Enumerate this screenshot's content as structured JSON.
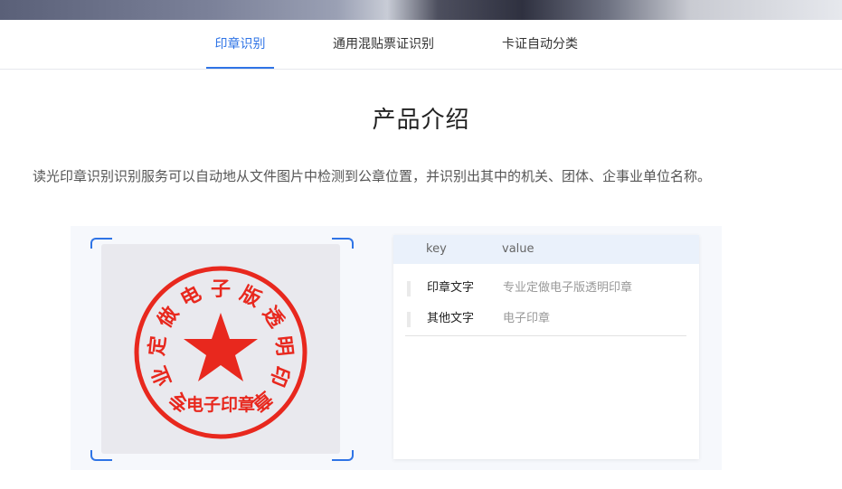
{
  "tabs": [
    {
      "label": "印章识别",
      "active": true
    },
    {
      "label": "通用混贴票证识别",
      "active": false
    },
    {
      "label": "卡证自动分类",
      "active": false
    }
  ],
  "section": {
    "title": "产品介绍",
    "description": "读光印章识别识别服务可以自动地从文件图片中检测到公章位置，并识别出其中的机关、团体、企事业单位名称。"
  },
  "demo": {
    "stamp": {
      "ring_text": "专业定做电子版透明印章",
      "center_text": "电子印章",
      "color": "#e8281e"
    },
    "table": {
      "headers": {
        "key": "key",
        "value": "value"
      },
      "rows": [
        {
          "key": "印章文字",
          "value": "专业定做电子版透明印章"
        },
        {
          "key": "其他文字",
          "value": "电子印章"
        }
      ]
    }
  },
  "colors": {
    "accent": "#2f74e6",
    "stamp_red": "#e8281e"
  }
}
